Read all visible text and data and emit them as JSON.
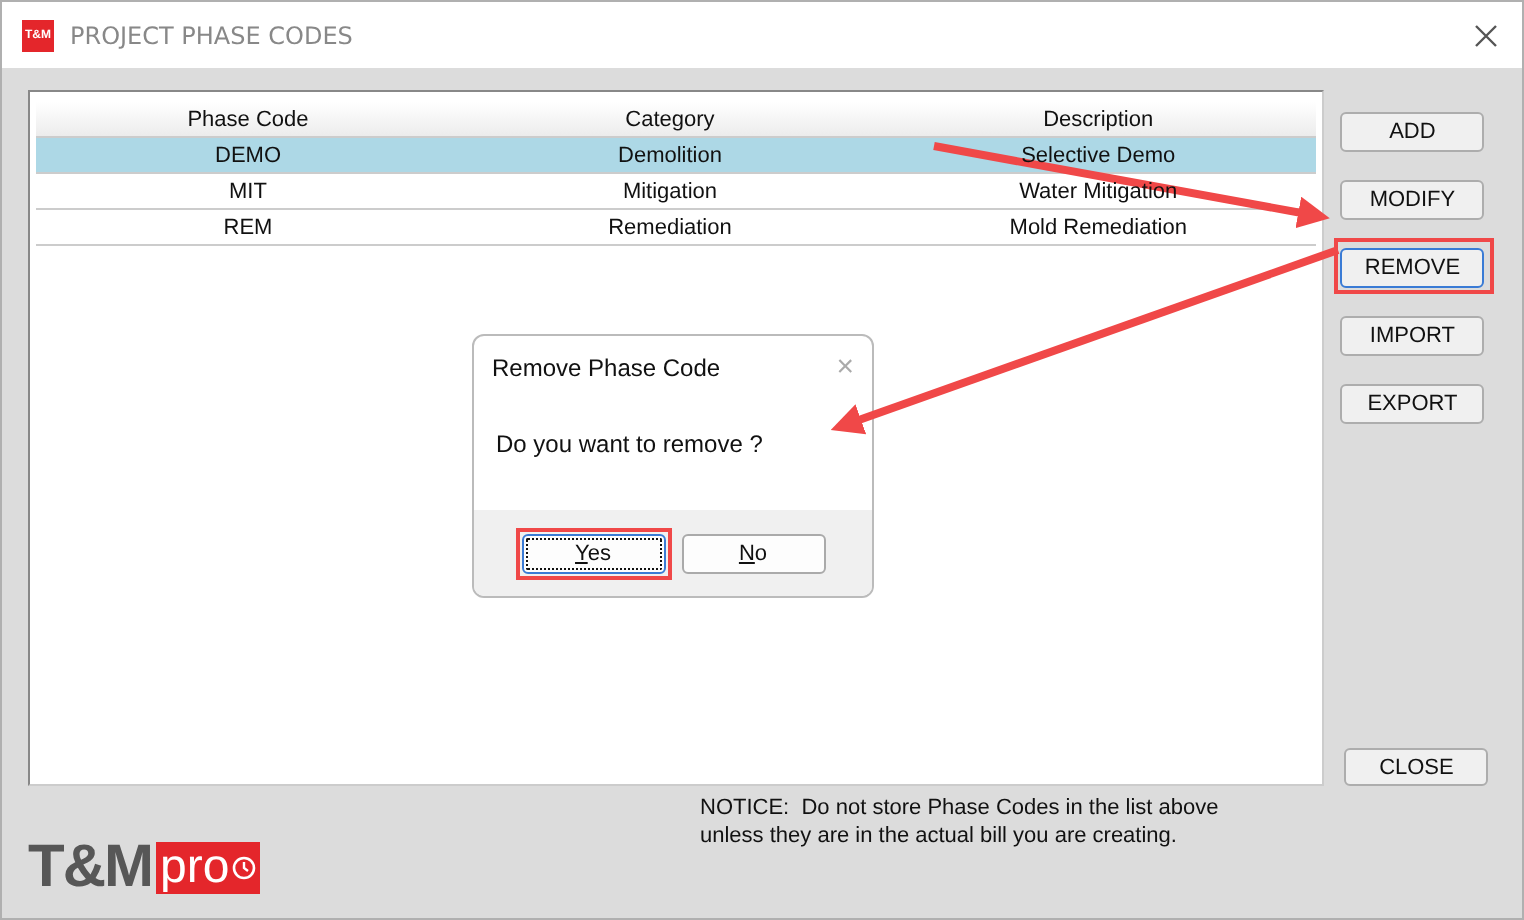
{
  "window": {
    "icon_text": "T&M",
    "title": "PROJECT PHASE CODES"
  },
  "table": {
    "columns": [
      "Phase Code",
      "Category",
      "Description"
    ],
    "rows": [
      {
        "cells": [
          "DEMO",
          "Demolition",
          "Selective Demo"
        ],
        "selected": true
      },
      {
        "cells": [
          "MIT",
          "Mitigation",
          "Water Mitigation"
        ],
        "selected": false
      },
      {
        "cells": [
          "REM",
          "Remediation",
          "Mold Remediation"
        ],
        "selected": false
      }
    ]
  },
  "side_buttons": [
    {
      "label": "ADD",
      "focused": false,
      "highlighted": false
    },
    {
      "label": "MODIFY",
      "focused": false,
      "highlighted": false
    },
    {
      "label": "REMOVE",
      "focused": true,
      "highlighted": true
    },
    {
      "label": "IMPORT",
      "focused": false,
      "highlighted": false
    },
    {
      "label": "EXPORT",
      "focused": false,
      "highlighted": false
    }
  ],
  "close_button": "CLOSE",
  "notice": "NOTICE:  Do not store Phase Codes in the list above unless they are in the actual bill you are creating.",
  "logo": {
    "main": "T&M",
    "accent": "pro"
  },
  "dialog": {
    "title": "Remove Phase Code",
    "close": "×",
    "message": "Do you want to remove ?",
    "buttons": [
      {
        "label": "Yes",
        "focused": true,
        "highlighted": true
      },
      {
        "label": "No",
        "focused": false,
        "highlighted": false
      }
    ]
  }
}
